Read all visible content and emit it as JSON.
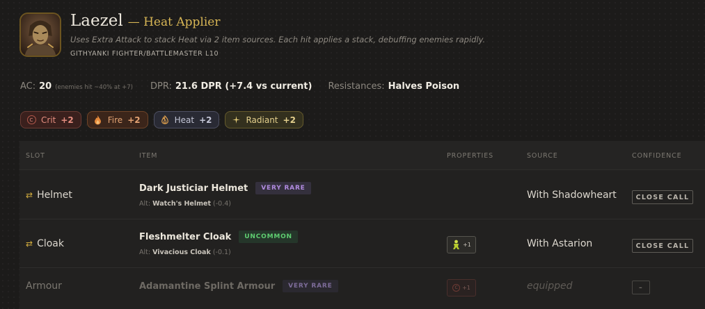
{
  "character": {
    "name": "Laezel",
    "role": "— Heat Applier",
    "tagline": "Uses Extra Attack to stack Heat via 2 item sources. Each hit applies a stack, debuffing enemies rapidly.",
    "class_line": "GITHYANKI FIGHTER/BATTLEMASTER L10"
  },
  "stats": {
    "ac_label": "AC:",
    "ac_value": "20",
    "ac_note": "(enemies hit ~40% at +7)",
    "dpr_label": "DPR:",
    "dpr_value": "21.6 DPR (+7.4 vs current)",
    "res_label": "Resistances:",
    "res_value": "Halves Poison"
  },
  "tags": [
    {
      "label": "Crit",
      "count": "+2",
      "icon": "crit-c-icon",
      "color": "#e48d7f"
    },
    {
      "label": "Fire",
      "count": "+2",
      "icon": "flame-icon",
      "color": "#e3a373"
    },
    {
      "label": "Heat",
      "count": "+2",
      "icon": "heat-swirl-icon",
      "color": "#c4c6d6"
    },
    {
      "label": "Radiant",
      "count": "+2",
      "icon": "sparkle-icon",
      "color": "#e4d08d"
    }
  ],
  "table": {
    "headers": {
      "slot": "SLOT",
      "item": "ITEM",
      "properties": "PROPERTIES",
      "source": "SOURCE",
      "confidence": "CONFIDENCE"
    },
    "rows": [
      {
        "swap_icon": "⇄",
        "slot": "Helmet",
        "item": "Dark Justiciar Helmet",
        "rarity": "VERY RARE",
        "alt_prefix": "Alt:",
        "alt_item": "Watch's Helmet",
        "alt_delta": "(-0.4)",
        "source": "With Shadowheart",
        "confidence": "CLOSE CALL"
      },
      {
        "swap_icon": "⇄",
        "slot": "Cloak",
        "item": "Fleshmelter Cloak",
        "rarity": "UNCOMMON",
        "alt_prefix": "Alt:",
        "alt_item": "Vivacious Cloak",
        "alt_delta": "(-0.1)",
        "property_count": "+1",
        "property_icon": "acid-figure-icon",
        "source": "With Astarion",
        "confidence": "CLOSE CALL"
      },
      {
        "slot": "Armour",
        "item": "Adamantine Splint Armour",
        "rarity": "VERY RARE",
        "property_count": "+1",
        "property_icon": "crit-c-icon",
        "source": "equipped",
        "confidence": "–"
      }
    ]
  }
}
